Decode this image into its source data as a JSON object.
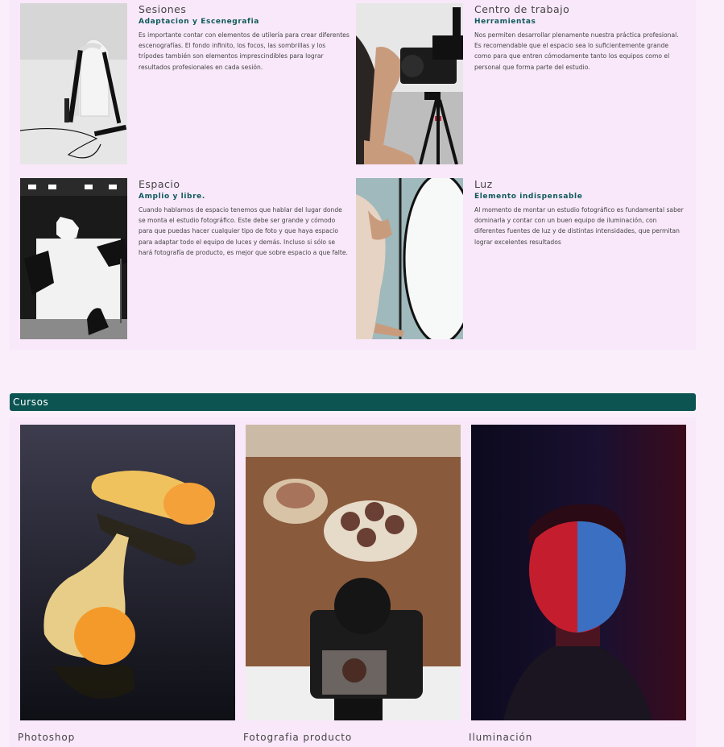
{
  "features": [
    {
      "title": "Sesiones",
      "subtitle": "Adaptacion y Escenegrafia",
      "body": "Es importante contar con elementos de utilería para crear diferentes escenografías. El fondo infinito, los focos, las sombrillas y los trípodes también son elementos imprescindibles para lograr resultados profesionales en cada sesión."
    },
    {
      "title": "Centro de trabajo",
      "subtitle": "Herramientas",
      "body": "Nos permiten desarrollar plenamente nuestra práctica profesional. Es recomendable que el espacio sea lo suficientemente grande como para que entren cómodamente tanto los equipos como el personal que forma parte del estudio."
    },
    {
      "title": "Espacio",
      "subtitle": "Amplio y libre.",
      "body": "Cuando hablamos de espacio tenemos que hablar del lugar donde se monta el estudio fotográfico. Este debe ser grande y cómodo para que puedas hacer cualquier tipo de foto y que haya espacio para adaptar todo el equipo de luces y demás. Incluso si sólo se hará fotografía de producto, es mejor que sobre espacio a que falte."
    },
    {
      "title": "Luz",
      "subtitle": "Elemento indispensable",
      "body": "Al momento de montar un estudio fotográfico es fundamental saber dominarla y contar con un buen equipo de iluminación, con diferentes fuentes de luz y de distintas intensidades, que permitan lograr excelentes resultados"
    }
  ],
  "courses_section": {
    "title": "Cursos"
  },
  "courses": [
    {
      "name": "Photoshop"
    },
    {
      "name": "Fotografia producto"
    },
    {
      "name": "Iluminación"
    }
  ],
  "colors": {
    "page_bg": "#faeefb",
    "panel_bg": "#f9e8fa",
    "accent": "#0b5452",
    "subtitle": "#0e5a5a"
  }
}
